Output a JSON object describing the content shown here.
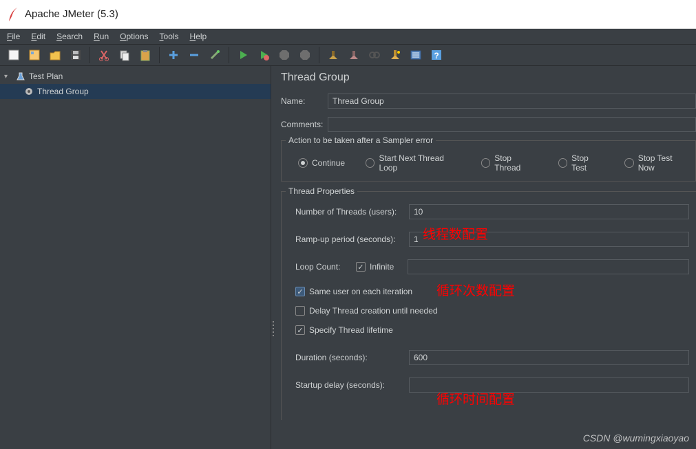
{
  "window": {
    "title": "Apache JMeter (5.3)"
  },
  "menu": {
    "file": "File",
    "edit": "Edit",
    "search": "Search",
    "run": "Run",
    "options": "Options",
    "tools": "Tools",
    "help": "Help"
  },
  "tree": {
    "root": "Test Plan",
    "child": "Thread Group"
  },
  "panel": {
    "title": "Thread Group",
    "name_lbl": "Name:",
    "name_val": "Thread Group",
    "comments_lbl": "Comments:",
    "comments_val": "",
    "action_legend": "Action to be taken after a Sampler error",
    "radios": {
      "continue": "Continue",
      "startnext": "Start Next Thread Loop",
      "stopthread": "Stop Thread",
      "stoptest": "Stop Test",
      "stoptestnow": "Stop Test Now"
    },
    "props_legend": "Thread Properties",
    "threads_lbl": "Number of Threads (users):",
    "threads_val": "10",
    "rampup_lbl": "Ramp-up period (seconds):",
    "rampup_val": "1",
    "loop_lbl": "Loop Count:",
    "infinite_lbl": "Infinite",
    "loop_val": "",
    "sameuser_lbl": "Same user on each iteration",
    "delay_lbl": "Delay Thread creation until needed",
    "lifetime_lbl": "Specify Thread lifetime",
    "duration_lbl": "Duration (seconds):",
    "duration_val": "600",
    "startup_lbl": "Startup delay (seconds):",
    "startup_val": ""
  },
  "annotations": {
    "threads": "线程数配置",
    "loop": "循环次数配置",
    "duration": "循环时间配置"
  },
  "watermark": "CSDN @wumingxiaoyao"
}
